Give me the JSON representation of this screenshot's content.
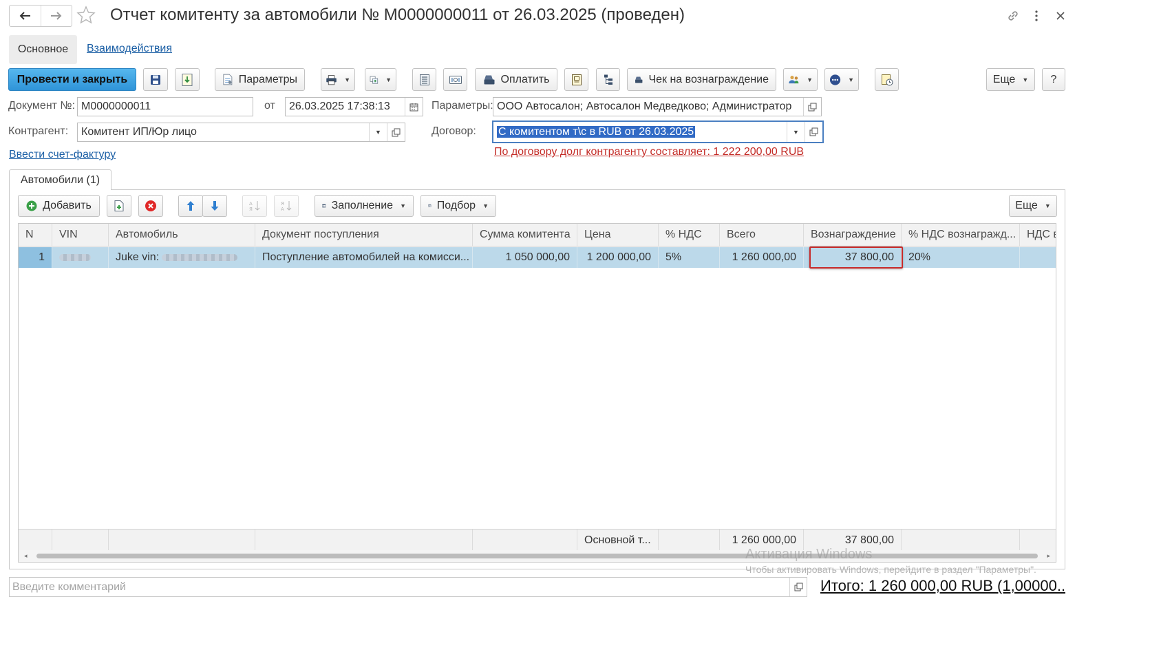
{
  "window": {
    "title": "Отчет комитенту за автомобили № M0000000011 от 26.03.2025 (проведен)"
  },
  "section_tabs": [
    {
      "label": "Основное",
      "active": true
    },
    {
      "label": "Взаимодействия",
      "active": false
    }
  ],
  "toolbar": {
    "post_close_label": "Провести и закрыть",
    "params_label": "Параметры",
    "pay_label": "Оплатить",
    "receipt_label": "Чек на вознаграждение",
    "more_label": "Еще",
    "help_label": "?"
  },
  "form": {
    "doc_number_label": "Документ №:",
    "doc_number_value": "M0000000011",
    "date_label": "от",
    "date_value": "26.03.2025 17:38:13",
    "params_label": "Параметры:",
    "params_value": "ООО Автосалон; Автосалон Медведково; Администратор",
    "counterparty_label": "Контрагент:",
    "counterparty_value": "Комитент ИП/Юр лицо",
    "contract_label": "Договор:",
    "contract_value": "С комитентом т\\с в RUB от 26.03.2025",
    "debt_message": "По договору долг контрагенту составляет: 1 222 200,00 RUB",
    "invoice_link": "Ввести счет-фактуру"
  },
  "cars_tab": {
    "label": "Автомобили (1)"
  },
  "table_toolbar": {
    "add_label": "Добавить",
    "fill_label": "Заполнение",
    "selection_label": "Подбор",
    "more_label": "Еще"
  },
  "table": {
    "columns": [
      "N",
      "VIN",
      "Автомобиль",
      "Документ поступления",
      "Сумма комитента",
      "Цена",
      "% НДС",
      "Всего",
      "Вознаграждение",
      "% НДС вознагражд...",
      "НДС в"
    ],
    "rows": [
      {
        "n": "1",
        "vin": "",
        "car_prefix": "Juke vin:",
        "receipt_doc": "Поступление автомобилей на комисси...",
        "committent_sum": "1 050 000,00",
        "price": "1 200 000,00",
        "vat_pct": "5%",
        "total": "1 260 000,00",
        "reward": "37 800,00",
        "reward_vat_pct": "20%",
        "vat_in": ""
      }
    ],
    "footer": {
      "price_label": "Основной т...",
      "total": "1 260 000,00",
      "reward": "37 800,00"
    }
  },
  "watermark": {
    "line1": "Активация Windows",
    "line2": "Чтобы активировать Windows, перейдите в раздел \"Параметры\"."
  },
  "comment": {
    "placeholder": "Введите комментарий"
  },
  "total_label": "Итого: 1 260 000,00 RUB (1,00000..."
}
